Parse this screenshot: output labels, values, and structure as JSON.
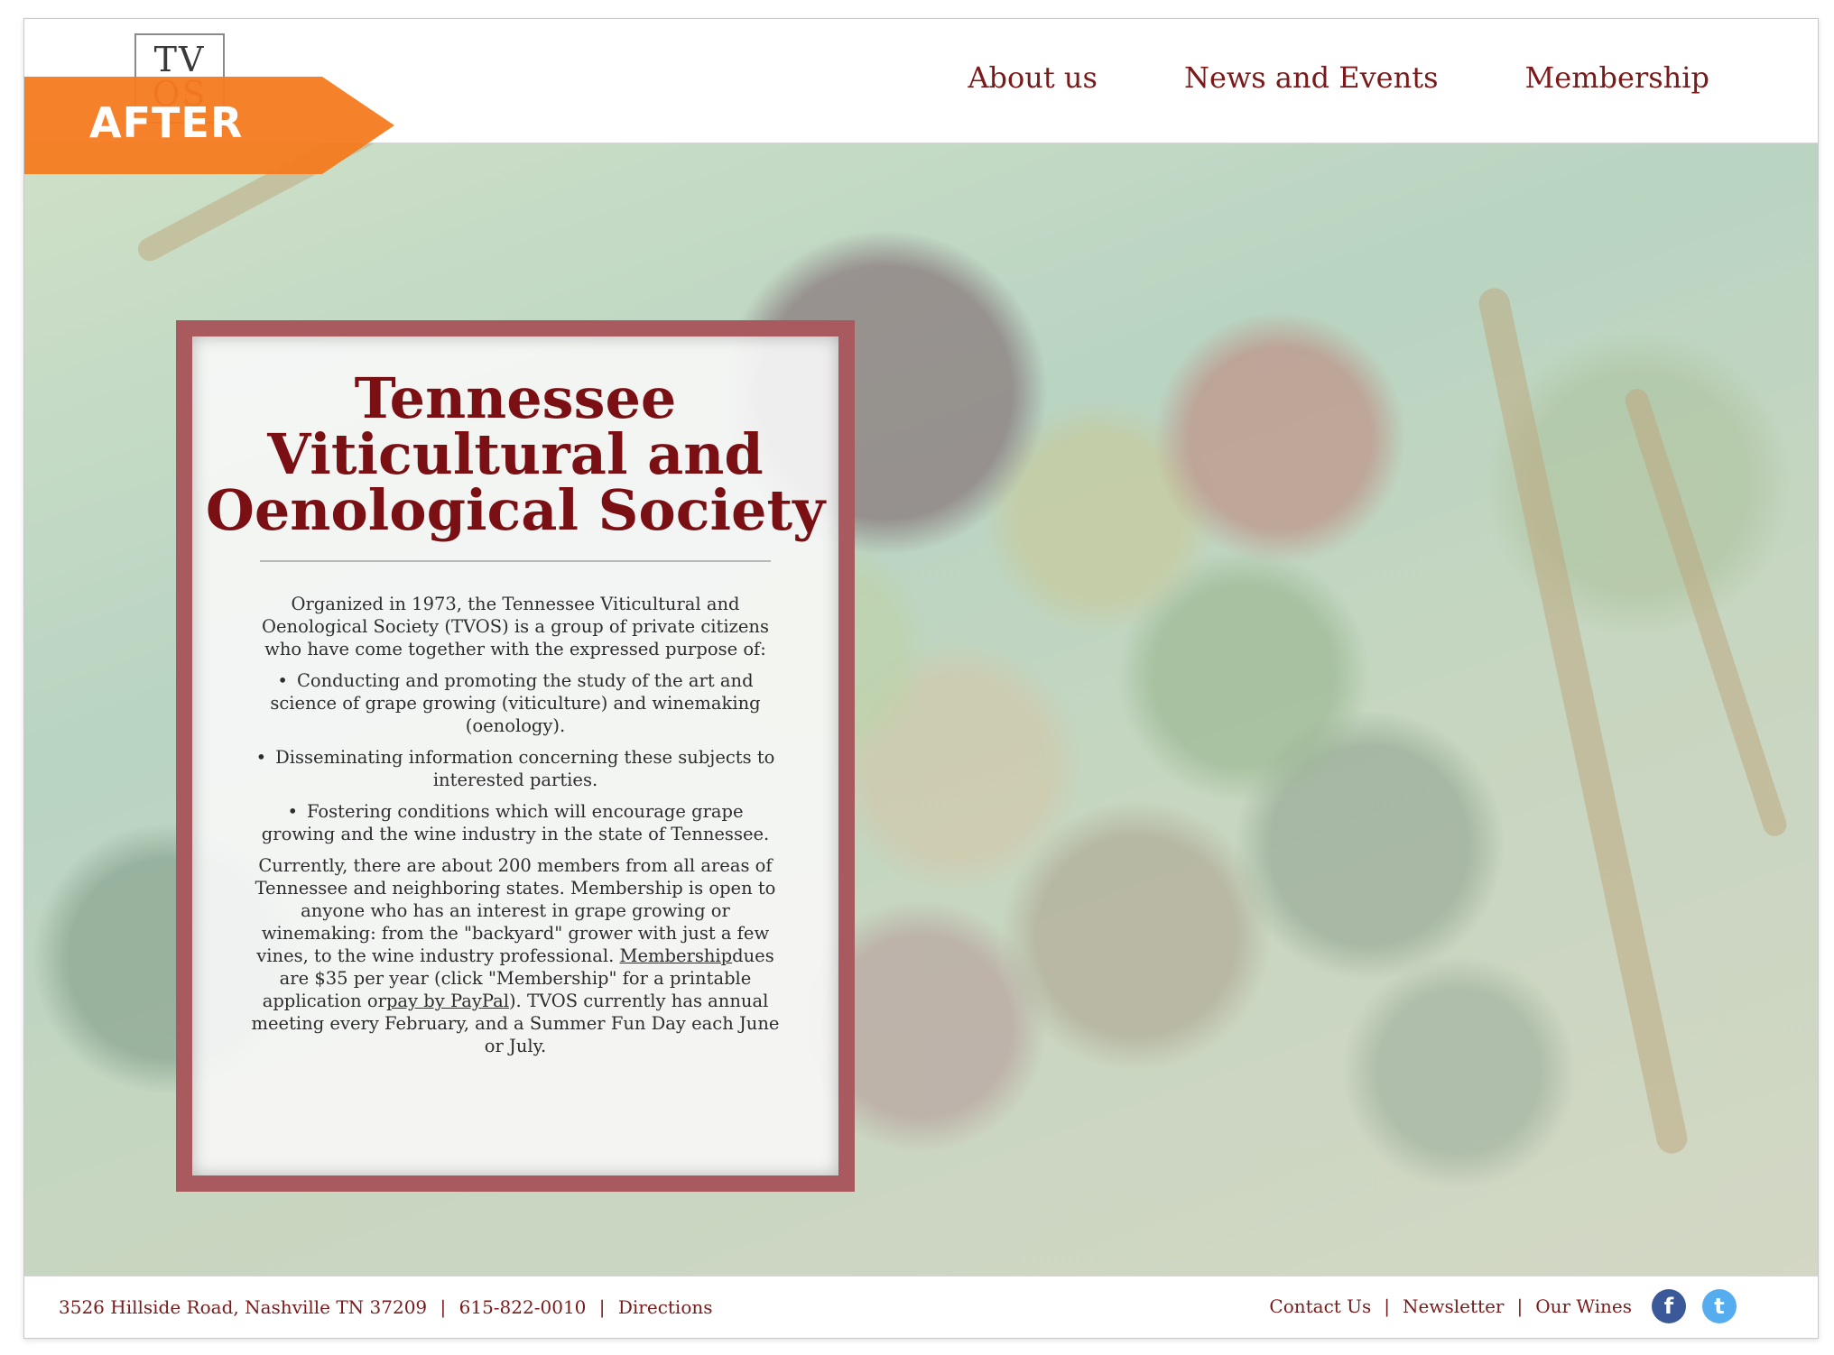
{
  "badge": {
    "label": "AFTER"
  },
  "header": {
    "logo_line1": "TV",
    "logo_line2": "OS",
    "nav": [
      {
        "label": "About us"
      },
      {
        "label": "News and Events"
      },
      {
        "label": "Membership"
      }
    ]
  },
  "main": {
    "title": "Tennessee Viticultural and Oenological Society",
    "intro": "Organized in 1973, the Tennessee Viticultural and Oenological Society (TVOS) is a group of private citizens who have come together with the expressed purpose of:",
    "bullets": [
      "Conducting and promoting the study of the art and science of grape growing (viticulture) and winemaking (oenology).",
      "Disseminating information concerning these subjects to interested parties.",
      "Fostering conditions which will encourage grape growing and the wine industry in the state of Tennessee."
    ],
    "bullet_char": "•",
    "para_part1": "Currently, there are about 200 members from all areas of Tennessee and neighboring states.  Membership is open to anyone who has an interest in grape growing or winemaking: from the \"backyard\" grower with just a few vines, to the wine industry professional.  ",
    "membership_link": "Membership",
    "para_part2": "dues are $35 per year (click \"Membership\" for a printable application or",
    "paypal_link": "pay by PayPal",
    "para_part3": ").  TVOS currently has annual meeting every February, and a Summer Fun Day each June or July."
  },
  "footer": {
    "address": "3526 Hillside Road, Nashville TN 37209",
    "phone": "615-822-0010",
    "directions": "Directions",
    "sep": "|",
    "links": [
      {
        "label": "Contact Us"
      },
      {
        "label": "Newsletter"
      },
      {
        "label": "Our Wines"
      }
    ],
    "facebook_glyph": "f",
    "twitter_glyph": "t"
  },
  "colors": {
    "brand": "#7a1a1a",
    "badge": "#f47b20",
    "box_border": "#a85a5e"
  }
}
